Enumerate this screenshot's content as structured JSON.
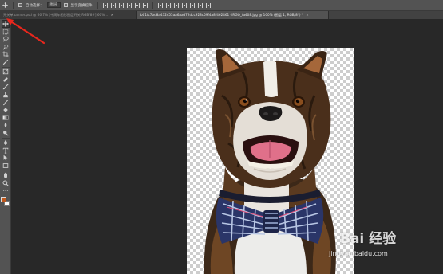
{
  "options_bar": {
    "auto_select_label": "自动选择：",
    "auto_select_value": "图层",
    "show_transform_label": "显示变换控件"
  },
  "tabs": [
    {
      "label": "开关单banner.psd @ 66.7% (十周年图形图层开关[RGB/8#] 60%...",
      "active": false,
      "close": "×"
    },
    {
      "label": "b01fc7bd8a432c55aa6aad72dcc928c59f4a8f462461 (IRGO_fa408.jpg @ 100% (图层 1, RGB/8*) *",
      "active": true,
      "close": "×"
    }
  ],
  "colors": {
    "foreground": "#c0581c",
    "background": "#ffffff",
    "arrow": "#e8271d",
    "accent": "#535353"
  },
  "toolbar": {
    "tools": [
      {
        "name": "move-tool-icon",
        "selected": true
      },
      {
        "name": "marquee-tool-icon"
      },
      {
        "name": "lasso-tool-icon"
      },
      {
        "name": "quick-select-tool-icon"
      },
      {
        "name": "crop-tool-icon"
      },
      {
        "name": "eyedropper-tool-icon"
      },
      {
        "name": "frame-tool-icon"
      },
      {
        "name": "healing-brush-tool-icon"
      },
      {
        "name": "brush-tool-icon"
      },
      {
        "name": "clone-stamp-tool-icon"
      },
      {
        "name": "history-brush-tool-icon"
      },
      {
        "name": "eraser-tool-icon"
      },
      {
        "name": "gradient-tool-icon"
      },
      {
        "name": "blur-tool-icon"
      },
      {
        "name": "dodge-tool-icon"
      },
      {
        "name": "pen-tool-icon"
      },
      {
        "name": "type-tool-icon"
      },
      {
        "name": "path-select-tool-icon"
      },
      {
        "name": "rectangle-tool-icon"
      },
      {
        "name": "hand-tool-icon"
      },
      {
        "name": "zoom-tool-icon"
      },
      {
        "name": "more-tools-icon"
      }
    ]
  },
  "watermark": {
    "logo_text": "Bai 经验",
    "url": "jingyan.baidu.com"
  }
}
